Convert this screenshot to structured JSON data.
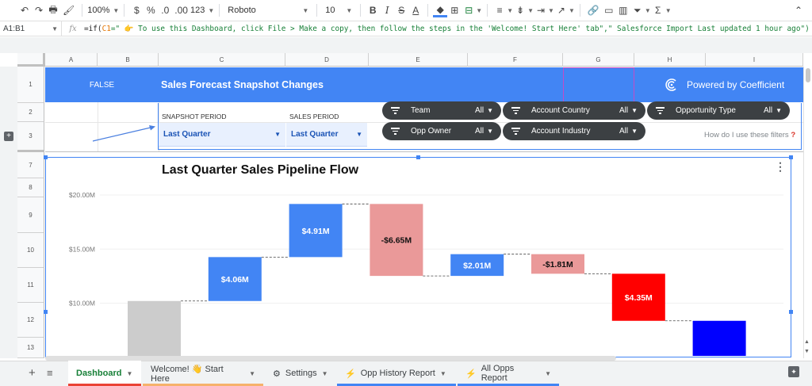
{
  "toolbar": {
    "zoom": "100%",
    "currency": "$",
    "percent": "%",
    "dec_less": ".0",
    "dec_more": ".00",
    "more_formats": "123",
    "font": "Roboto",
    "font_size": "10"
  },
  "formula_bar": {
    "cell_ref": "A1:B1",
    "fx": "fx",
    "formula_start": "=if(",
    "formula_ref": "C1",
    "formula_text": "=\" 👉 To use this Dashboard, click File > Make a copy, then follow the steps in the 'Welcome! Start Here' tab\",\" Salesforce Import Last updated 1 hour ago\")"
  },
  "columns": [
    "A",
    "B",
    "C",
    "D",
    "E",
    "F",
    "G",
    "H",
    "I"
  ],
  "rows": [
    "1",
    "2",
    "3",
    "7",
    "8",
    "9",
    "10",
    "11",
    "12",
    "13"
  ],
  "banner": {
    "cell_value": "FALSE",
    "title": "Sales Forecast Snapshot Changes",
    "powered_by": "Powered by Coefficient"
  },
  "filters": {
    "snapshot_label": "SNAPSHOT PERIOD",
    "snapshot_value": "Last Quarter",
    "sales_label": "SALES PERIOD",
    "sales_value": "Last Quarter",
    "pills": [
      {
        "name": "Team",
        "value": "All"
      },
      {
        "name": "Account Country",
        "value": "All"
      },
      {
        "name": "Opportunity Type",
        "value": "All"
      },
      {
        "name": "Opp Owner",
        "value": "All"
      },
      {
        "name": "Account Industry",
        "value": "All"
      }
    ],
    "help_text": "How do I use these filters",
    "help_mark": "?"
  },
  "chart_data": {
    "type": "bar",
    "subtype": "waterfall",
    "title": "Last Quarter Sales Pipeline Flow",
    "y_ticks": [
      "$10.00M",
      "$15.00M",
      "$20.00M"
    ],
    "ylim": [
      7.5,
      21.5
    ],
    "bars": [
      {
        "start": 0,
        "end": 10.2,
        "label": "",
        "color": "#cccccc"
      },
      {
        "start": 10.2,
        "end": 14.26,
        "label": "$4.06M",
        "color": "#4285f4"
      },
      {
        "start": 14.26,
        "end": 19.17,
        "label": "$4.91M",
        "color": "#4285f4"
      },
      {
        "start": 19.17,
        "end": 12.52,
        "label": "-$6.65M",
        "color": "#ea9999"
      },
      {
        "start": 12.52,
        "end": 14.53,
        "label": "$2.01M",
        "color": "#4285f4"
      },
      {
        "start": 14.53,
        "end": 12.72,
        "label": "-$1.81M",
        "color": "#ea9999"
      },
      {
        "start": 12.72,
        "end": 8.37,
        "label": "$4.35M",
        "color": "#ff0000"
      },
      {
        "start": 0,
        "end": 8.37,
        "label": "",
        "color": "#0000ff"
      }
    ],
    "legend": "none"
  },
  "tabs": [
    {
      "label": "Dashboard",
      "color": "#ea4335",
      "active": true,
      "prefix": ""
    },
    {
      "label": "Welcome! 👋 Start Here",
      "color": "#f6b26b",
      "active": false,
      "prefix": ""
    },
    {
      "label": "Settings",
      "color": "",
      "active": false,
      "prefix": "⚙"
    },
    {
      "label": "Opp History Report",
      "color": "#4285f4",
      "active": false,
      "prefix": "⚡"
    },
    {
      "label": "All Opps Report",
      "color": "#4285f4",
      "active": false,
      "prefix": "⚡"
    }
  ]
}
